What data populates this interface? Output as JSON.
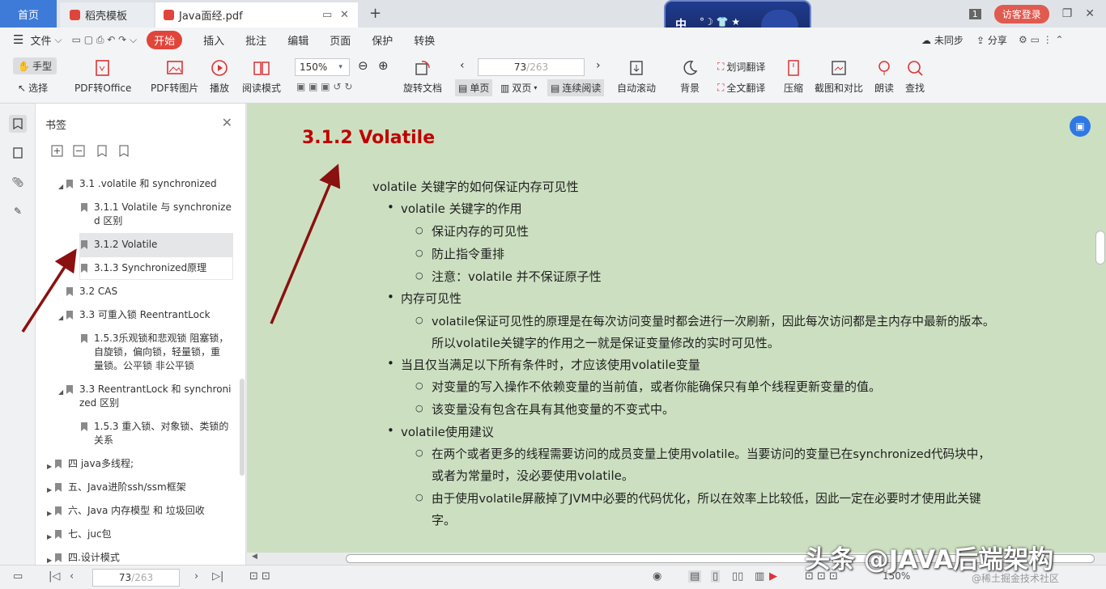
{
  "tabs": {
    "home": "首页",
    "template": "稻壳模板",
    "pdf": "Java面经.pdf"
  },
  "banner": {
    "text": "中"
  },
  "guest_login": "访客登录",
  "page_badge": "1",
  "menu": [
    "文件",
    "开始",
    "插入",
    "批注",
    "编辑",
    "页面",
    "保护",
    "转换"
  ],
  "menu_right": {
    "sync": "未同步",
    "share": "分享"
  },
  "ribbon": {
    "hand": "手型",
    "select": "选择",
    "pdf_to_office": "PDF转Office",
    "pdf_to_image": "PDF转图片",
    "play": "播放",
    "read_mode": "阅读模式",
    "zoom": "150%",
    "rotate": "旋转文档",
    "page_current": "73",
    "page_total": "/263",
    "single": "单页",
    "double": "双页",
    "continuous": "连续阅读",
    "auto_scroll": "自动滚动",
    "background": "背景",
    "word_translate": "划词翻译",
    "full_translate": "全文翻译",
    "compress": "压缩",
    "screenshot": "截图和对比",
    "read_aloud": "朗读",
    "find": "查找"
  },
  "panel": {
    "title": "书签",
    "items": [
      {
        "label": "3.1 .volatile 和 synchronized",
        "tri": "◢"
      },
      {
        "label": "3.1.1 Volatile 与 synchronize",
        "label2": "d 区别"
      },
      {
        "label": "3.1.2 Volatile"
      },
      {
        "label": "3.1.3 Synchronized原理"
      },
      {
        "label": "3.2  CAS"
      },
      {
        "label": "3.3 可重入锁 ReentrantLock",
        "tri": "◢"
      },
      {
        "label": "1.5.3乐观锁和悲观锁 阻塞锁，",
        "label2": "自旋锁，偏向锁，轻量锁，重",
        "label3": "量锁。公平锁 非公平锁"
      },
      {
        "label": "3.3 ReentrantLock 和 synchroni",
        "label2": "zed 区别",
        "tri": "◢"
      },
      {
        "label": "1.5.3 重入锁、对象锁、类锁的",
        "label2": "关系"
      },
      {
        "label": "四 java多线程;",
        "tri": "▶"
      },
      {
        "label": "五、Java进阶ssh/ssm框架",
        "tri": "▶"
      },
      {
        "label": "六、Java 内存模型 和 垃圾回收",
        "tri": "▶"
      },
      {
        "label": "七、juc包",
        "tri": "▶"
      },
      {
        "label": "四.设计模式",
        "tri": "▶"
      }
    ]
  },
  "doc": {
    "heading": "3.1.2 Volatile",
    "lines": [
      "volatile 关键字的如何保证内存可见性",
      "volatile 关键字的作用",
      "保证内存的可见性",
      "防止指令重排",
      "注意：volatile 并不保证原子性",
      "内存可见性",
      "volatile保证可见性的原理是在每次访问变量时都会进行一次刷新，因此每次访问都是主内存中最新的版本。",
      "所以volatile关键字的作用之一就是保证变量修改的实时可见性。",
      "当且仅当满足以下所有条件时，才应该使用volatile变量",
      "对变量的写入操作不依赖变量的当前值，或者你能确保只有单个线程更新变量的值。",
      "该变量没有包含在具有其他变量的不变式中。",
      "volatile使用建议",
      "在两个或者更多的线程需要访问的成员变量上使用volatile。当要访问的变量已在synchronized代码块中，",
      "或者为常量时，没必要使用volatile。",
      "由于使用volatile屏蔽掉了JVM中必要的代码优化，所以在效率上比较低，因此一定在必要时才使用此关键",
      "字。"
    ]
  },
  "status": {
    "page_current": "73",
    "page_total": "/263",
    "zoom": "150%"
  },
  "watermark": "头条 @JAVA后端架构",
  "watermark2": "@稀土掘金技术社区",
  "colors": {
    "accent": "#e0453a",
    "heading": "#c00000",
    "doc_bg": "#cce0c1",
    "arrow": "#8b1010"
  }
}
